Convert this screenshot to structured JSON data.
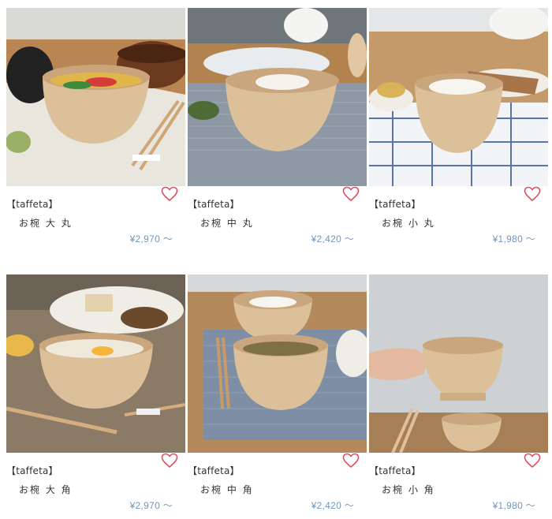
{
  "theme": {
    "price_color": "#6f96bf",
    "heart_color": "#e04b5a"
  },
  "products": [
    {
      "brand": "【taffeta】",
      "name": "お椀 大 丸",
      "price": "¥2,970 ～",
      "favorite_icon": "heart-outline-icon"
    },
    {
      "brand": "【taffeta】",
      "name": "お椀 中 丸",
      "price": "¥2,420 ～",
      "favorite_icon": "heart-outline-icon"
    },
    {
      "brand": "【taffeta】",
      "name": "お椀 小 丸",
      "price": "¥1,980 ～",
      "favorite_icon": "heart-outline-icon"
    },
    {
      "brand": "【taffeta】",
      "name": "お椀 大 角",
      "price": "¥2,970 ～",
      "favorite_icon": "heart-outline-icon"
    },
    {
      "brand": "【taffeta】",
      "name": "お椀 中 角",
      "price": "¥2,420 ～",
      "favorite_icon": "heart-outline-icon"
    },
    {
      "brand": "【taffeta】",
      "name": "お椀 小 角",
      "price": "¥1,980 ～",
      "favorite_icon": "heart-outline-icon"
    }
  ]
}
